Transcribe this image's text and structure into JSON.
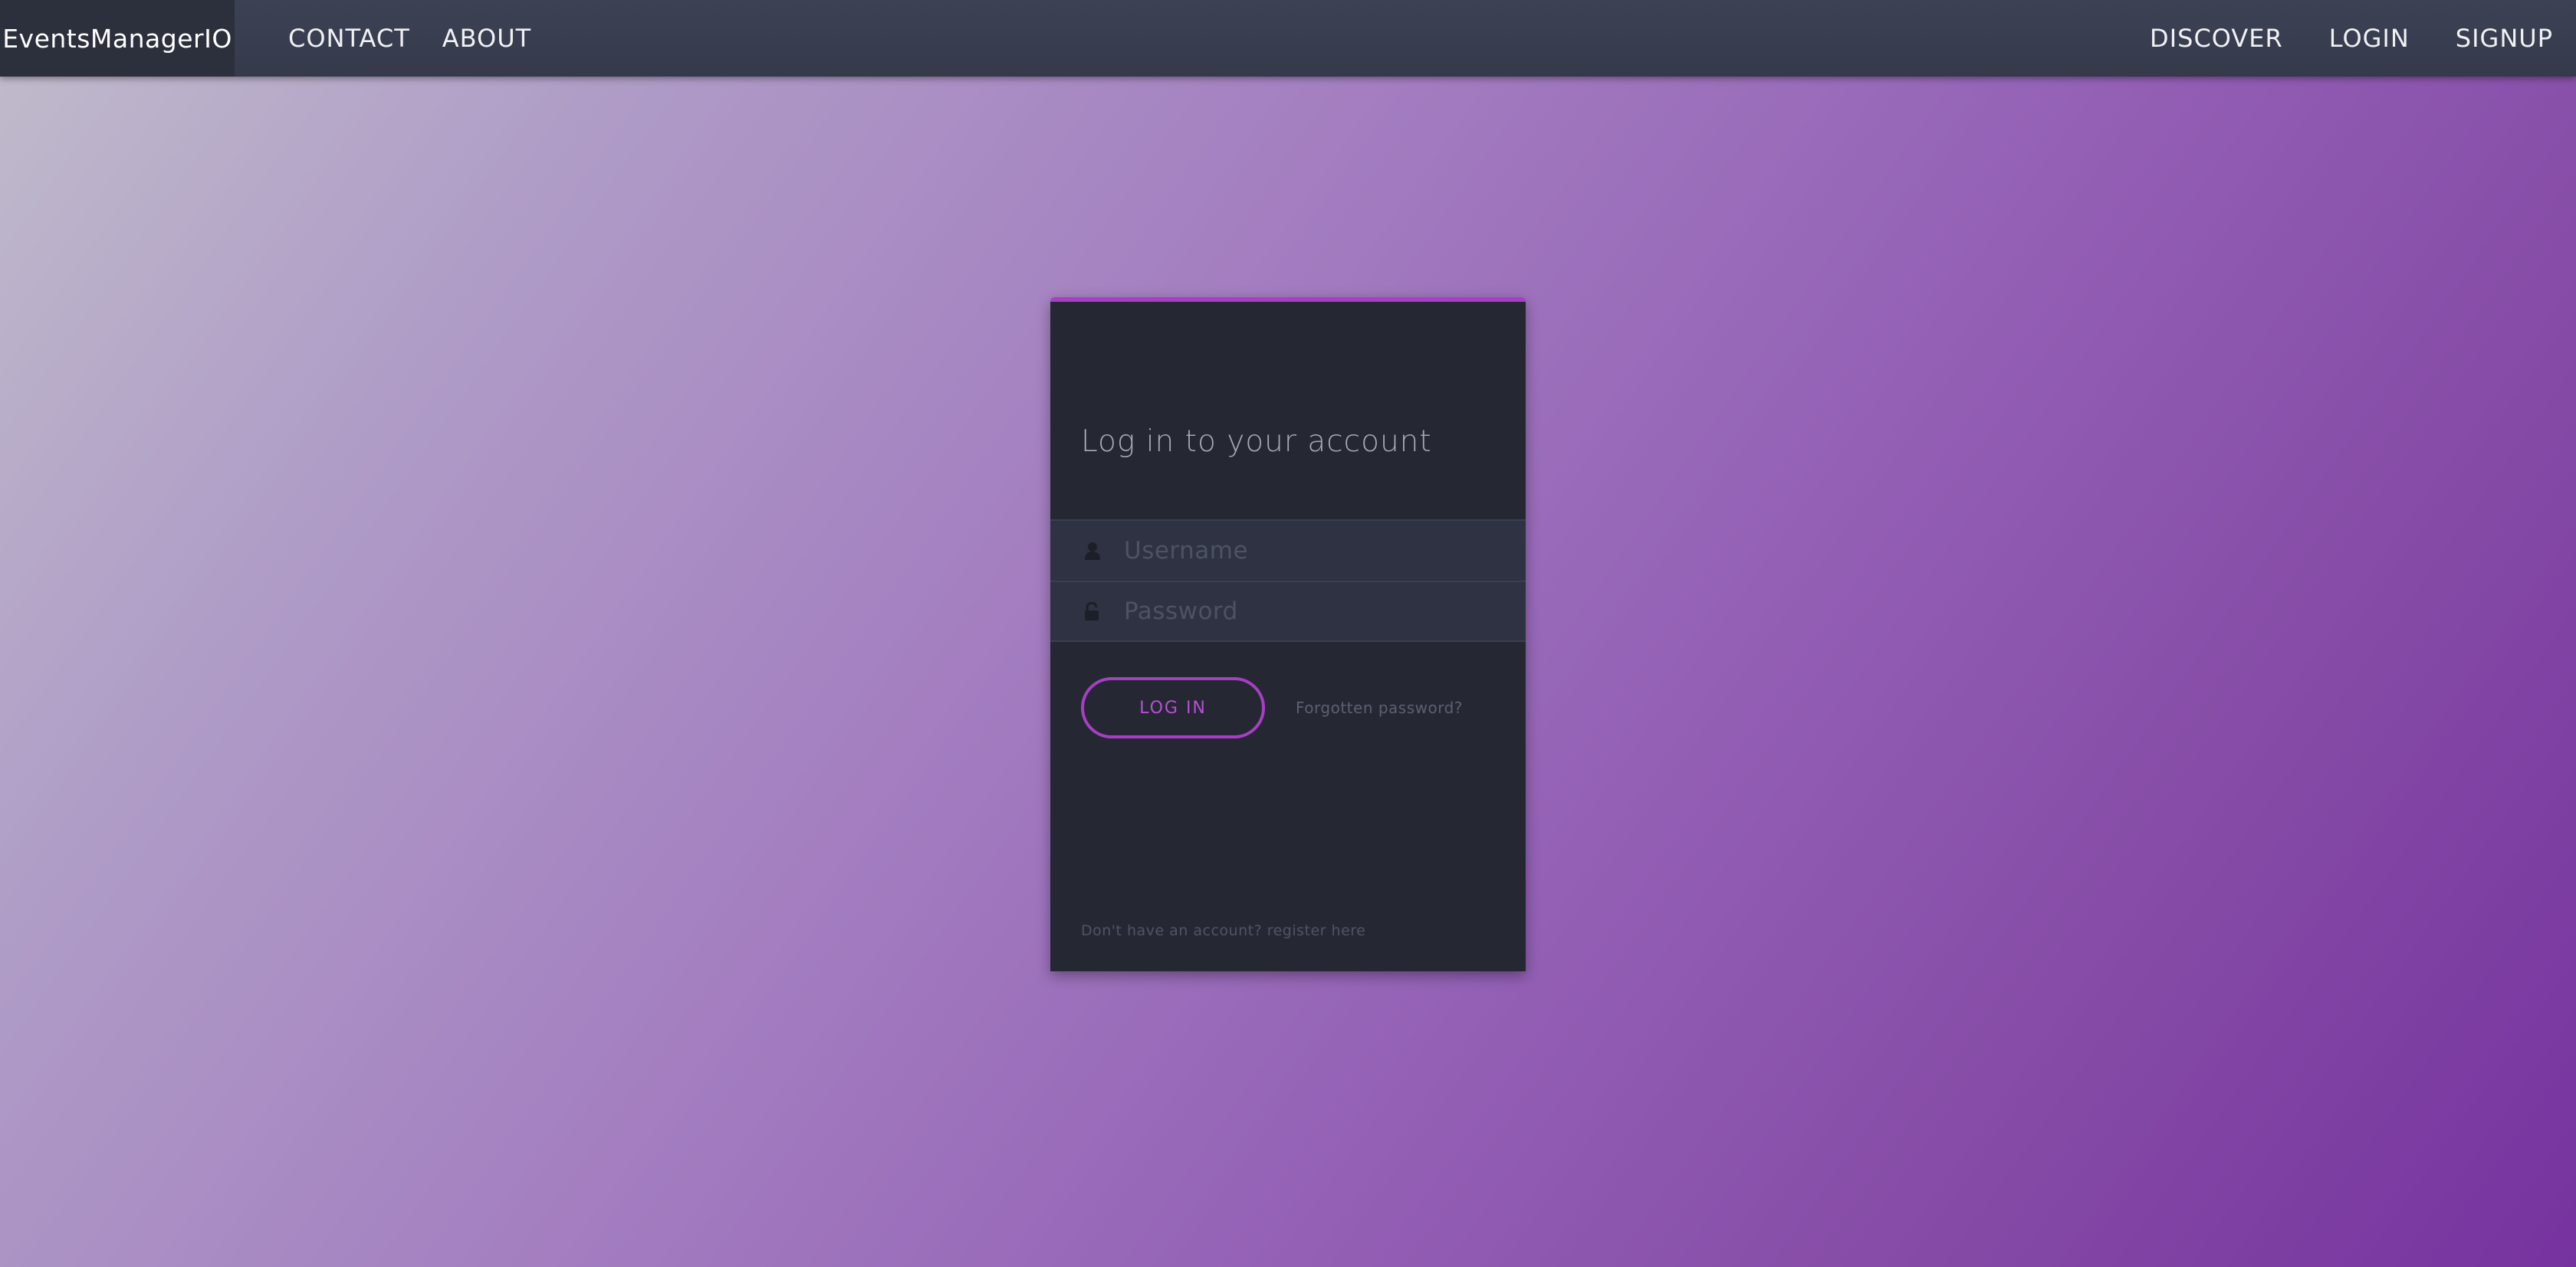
{
  "navbar": {
    "brand": "EventsManagerIO",
    "left_links": [
      {
        "label": "CONTACT"
      },
      {
        "label": "ABOUT"
      }
    ],
    "right_links": [
      {
        "label": "DISCOVER"
      },
      {
        "label": "LOGIN"
      },
      {
        "label": "SIGNUP"
      }
    ]
  },
  "login_card": {
    "title": "Log in to your account",
    "username": {
      "placeholder": "Username",
      "value": "",
      "icon": "user-icon"
    },
    "password": {
      "placeholder": "Password",
      "value": "",
      "icon": "lock-icon"
    },
    "login_button_label": "LOG IN",
    "forgot_password_label": "Forgotten password?",
    "register_prompt": "Don't have an account?",
    "register_link_label": "register here"
  },
  "colors": {
    "accent": "#a73fc5",
    "navbar": "#3a3f50",
    "card_background": "#252833"
  }
}
